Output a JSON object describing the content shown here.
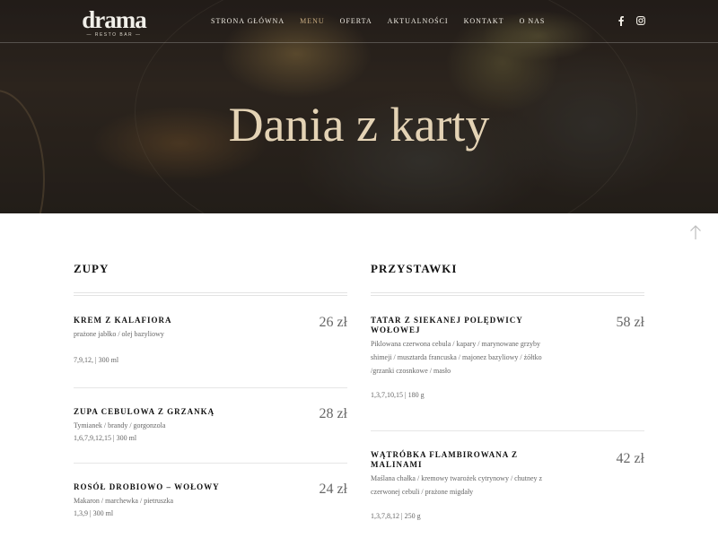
{
  "brand": {
    "logo_word": "drama",
    "logo_sub": "— RESTO BAR —"
  },
  "nav": {
    "items": [
      {
        "label": "STRONA GŁÓWNA",
        "active": false
      },
      {
        "label": "MENU",
        "active": true
      },
      {
        "label": "OFERTA",
        "active": false
      },
      {
        "label": "AKTUALNOŚCI",
        "active": false
      },
      {
        "label": "KONTAKT",
        "active": false
      },
      {
        "label": "O NAS",
        "active": false
      }
    ],
    "social": [
      "facebook-icon",
      "instagram-icon"
    ]
  },
  "hero": {
    "title": "Dania z karty"
  },
  "colors": {
    "accent": "#c9ad82",
    "hero_title": "#e4d3b5",
    "text_muted": "#666666"
  },
  "menu": {
    "left": {
      "heading": "ZUPY",
      "dishes": [
        {
          "name": "KREM Z KALAFIORA",
          "desc": "prażone jabłko / olej bazyliowy",
          "allergens": "7,9,12, | 300 ml",
          "price": "26 zł"
        },
        {
          "name": "ZUPA CEBULOWA Z GRZANKĄ",
          "desc": "Tymianek / brandy / gorgonzola",
          "allergens": "1,6,7,9,12,15 | 300 ml",
          "price": "28 zł"
        },
        {
          "name": "ROSÓŁ DROBIOWO – WOŁOWY",
          "desc": "Makaron / marchewka / pietruszka",
          "allergens": "1,3,9 | 300 ml",
          "price": "24 zł"
        }
      ]
    },
    "right": {
      "heading": "PRZYSTAWKI",
      "dishes": [
        {
          "name": "TATAR Z SIEKANEJ POLĘDWICY WOŁOWEJ",
          "desc": "Piklowana czerwona cebula / kapary / marynowane grzyby shimeji / musztarda francuska / majonez bazyliowy / żółtko /grzanki czosnkowe / masło",
          "allergens": "1,3,7,10,15 | 180 g",
          "price": "58 zł"
        },
        {
          "name": "WĄTRÓBKA FLAMBIROWANA Z MALINAMI",
          "desc": "Maślana chałka / kremowy twarożek cytrynowy / chutney z czerwonej cebuli / prażone migdały",
          "allergens": "1,3,7,8,12 | 250 g",
          "price": "42 zł"
        }
      ]
    }
  }
}
